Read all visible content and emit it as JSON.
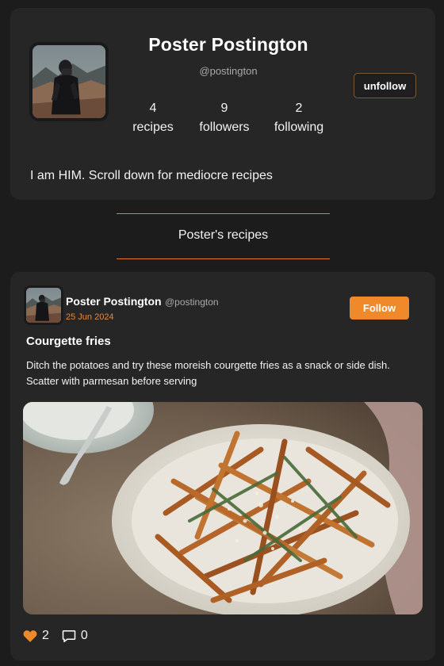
{
  "profile": {
    "name": "Poster Postington",
    "handle": "@postington",
    "stats": [
      {
        "value": "4",
        "label": "recipes"
      },
      {
        "value": "9",
        "label": "followers"
      },
      {
        "value": "2",
        "label": "following"
      }
    ],
    "unfollow_label": "unfollow",
    "bio": "I am HIM. Scroll down for mediocre recipes"
  },
  "section": {
    "title": "Poster's recipes"
  },
  "post": {
    "author": "Poster Postington",
    "handle": "@postington",
    "date": "25 Jun 2024",
    "follow_label": "Follow",
    "title": "Courgette fries",
    "description": "Ditch the potatoes and try these moreish courgette fries as a snack or side dish. Scatter with parmesan before serving",
    "likes": "2",
    "comments": "0"
  },
  "icons": {
    "like": "heart-icon",
    "comment": "comment-icon"
  },
  "colors": {
    "background": "#1c1c1c",
    "card": "#262626",
    "accent": "#f0892a",
    "date": "#e8893a",
    "divider": "#e07f3a"
  }
}
